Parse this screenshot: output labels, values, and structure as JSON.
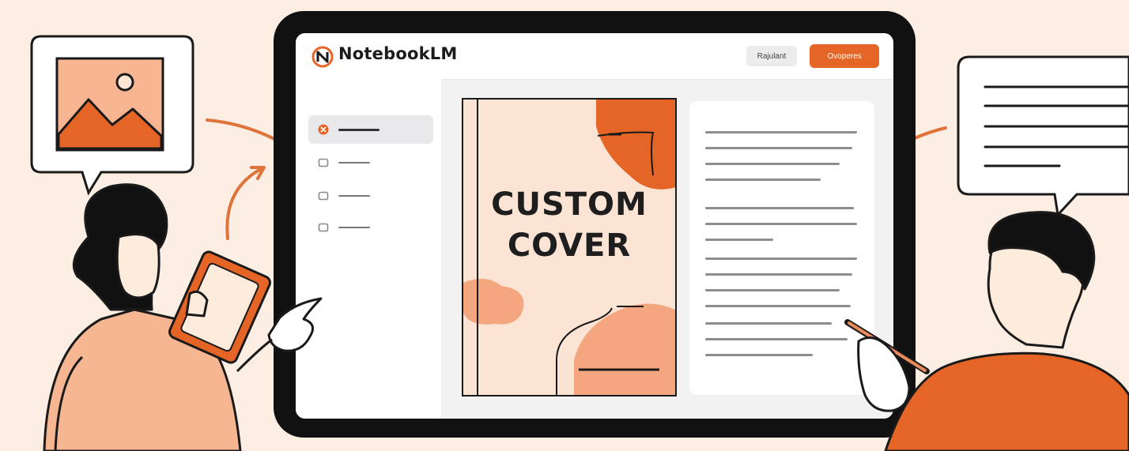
{
  "app": {
    "name": "NotebookLM",
    "secondary_button": "Rajulant",
    "primary_button": "Ovoperes"
  },
  "cover": {
    "line1": "CUSTOM",
    "line2": "COVER"
  },
  "colors": {
    "accent": "#e46526",
    "background": "#fdeee3",
    "peach": "#f4a77f",
    "ink": "#111111"
  },
  "sidebar": {
    "items": [
      {
        "icon": "brand-icon",
        "active": true
      },
      {
        "icon": "square-icon",
        "active": false
      },
      {
        "icon": "square-icon",
        "active": false
      },
      {
        "icon": "square-icon",
        "active": false
      }
    ]
  },
  "illustration": {
    "left_bubble_icon": "image-icon",
    "right_bubble_icon": "text-lines-icon"
  }
}
